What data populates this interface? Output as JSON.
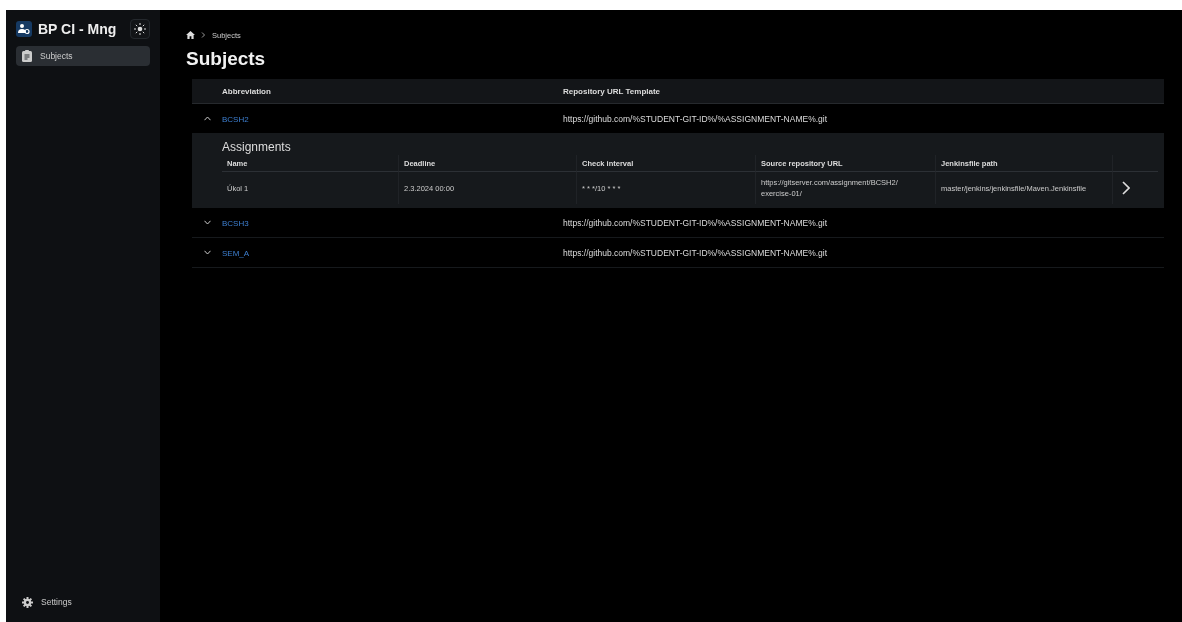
{
  "sidebar": {
    "app_title": "BP CI - Mng",
    "items": [
      {
        "label": "Subjects",
        "selected": true
      }
    ],
    "footer_item": "Settings"
  },
  "breadcrumb": [
    "Subjects"
  ],
  "page_title": "Subjects",
  "table": {
    "columns": [
      "Abbreviation",
      "Repository URL Template"
    ],
    "rows": [
      {
        "abbreviation": "BCSH2",
        "template": "https://github.com/%STUDENT-GIT-ID%/%ASSIGNMENT-NAME%.git",
        "expanded": true,
        "assignments": {
          "title": "Assignments",
          "columns": [
            "Name",
            "Deadline",
            "Check interval",
            "Source repository URL",
            "Jenkinsfile path"
          ],
          "rows": [
            [
              "Úkol 1",
              "2.3.2024 00:00",
              "* * */10 * * *",
              "https://gitserver.com/assignment/BCSH2/ exercise-01/",
              "master/jenkins/jenkinsfile/Maven.Jenkinsfile"
            ]
          ]
        }
      },
      {
        "abbreviation": "BCSH3",
        "template": "https://github.com/%STUDENT-GIT-ID%/%ASSIGNMENT-NAME%.git",
        "expanded": false
      },
      {
        "abbreviation": "SEM_A",
        "template": "https://github.com/%STUDENT-GIT-ID%/%ASSIGNMENT-NAME%.git",
        "expanded": false
      }
    ]
  }
}
